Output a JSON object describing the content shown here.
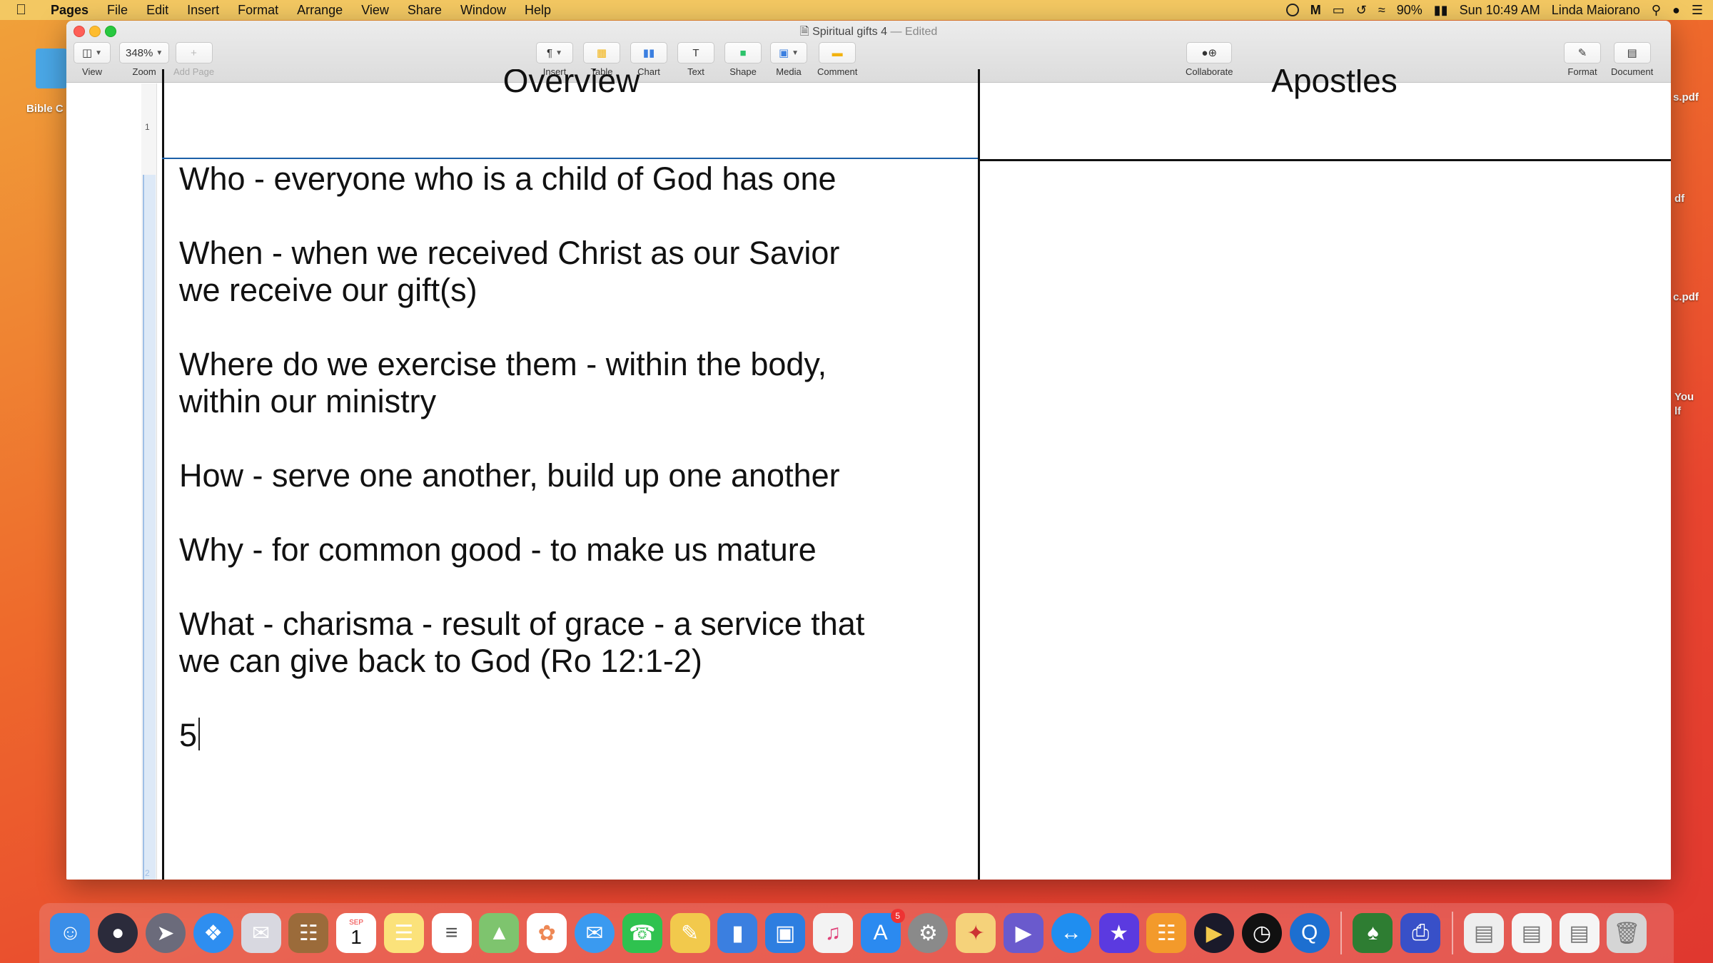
{
  "menubar": {
    "app_name": "Pages",
    "items": [
      "File",
      "Edit",
      "Insert",
      "Format",
      "Arrange",
      "View",
      "Share",
      "Window",
      "Help"
    ],
    "battery": "90%",
    "clock": "Sun 10:49 AM",
    "user": "Linda Maiorano"
  },
  "desktop": {
    "folder_label": "Bible C",
    "side_labels": [
      "s.pdf",
      "df",
      "c.pdf",
      "You",
      "lf"
    ]
  },
  "window": {
    "doc_name": "Spiritual gifts 4",
    "doc_status": "— Edited"
  },
  "toolbar": {
    "view_label": "View",
    "zoom_value": "348%",
    "zoom_label": "Zoom",
    "add_page_label": "Add Page",
    "insert_label": "Insert",
    "table_label": "Table",
    "chart_label": "Chart",
    "text_label": "Text",
    "shape_label": "Shape",
    "media_label": "Media",
    "comment_label": "Comment",
    "collaborate_label": "Collaborate",
    "format_label": "Format",
    "document_label": "Document"
  },
  "gutter": {
    "row1": "1",
    "row2": "2"
  },
  "table": {
    "header_left": "Overview",
    "header_right": "Apostles",
    "lines": [
      "Who - everyone who is a child of God has one",
      "When - when we received Christ as our Savior we receive our gift(s)",
      "Where do we exercise them - within the body, within our ministry",
      "How - serve one another, build up one another",
      "Why - for common good - to make us mature",
      "What - charisma - result of grace - a service that we can give back to God (Ro 12:1-2)",
      "5"
    ]
  },
  "dock": {
    "calendar_month": "SEP",
    "calendar_day": "1",
    "appstore_badge": "5"
  },
  "colors": {
    "menubar": "#f3c862",
    "selection": "#dde9f7",
    "table_line": "#111111"
  }
}
